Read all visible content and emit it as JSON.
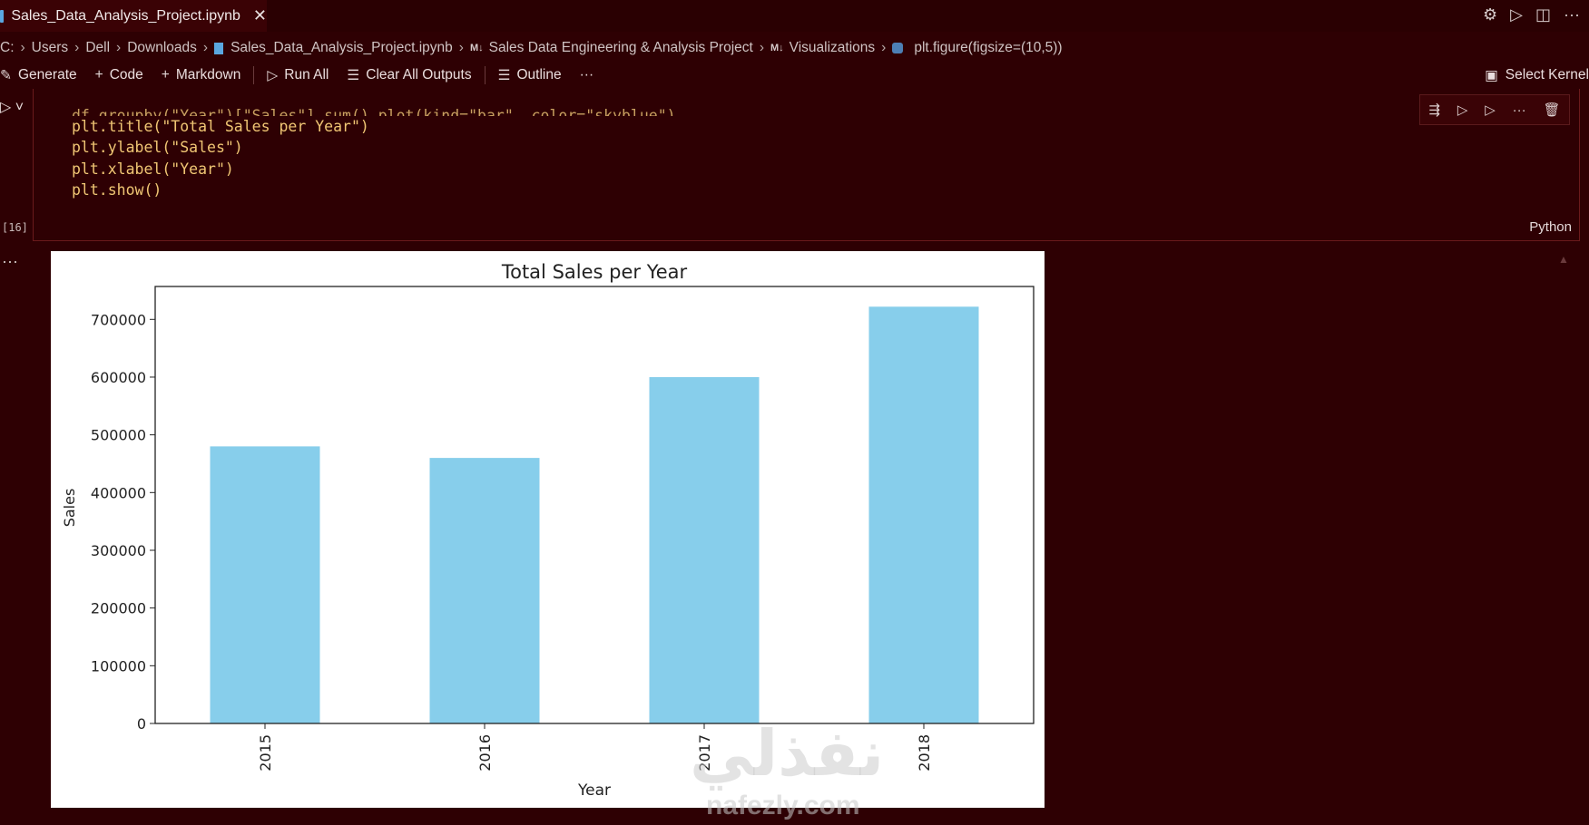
{
  "tab": {
    "title": "Sales_Data_Analysis_Project.ipynb",
    "close": "✕"
  },
  "tab_actions": [
    "gear-icon",
    "run-icon",
    "split-icon",
    "more-icon"
  ],
  "breadcrumb": {
    "items": [
      "C:",
      "Users",
      "Dell",
      "Downloads",
      "Sales_Data_Analysis_Project.ipynb",
      "Sales Data Engineering & Analysis Project",
      "Visualizations",
      "plt.figure(figsize=(10,5))"
    ],
    "md_badge": "M↓"
  },
  "toolbar": {
    "generate": "Generate",
    "code": "Code",
    "markdown": "Markdown",
    "run_all": "Run All",
    "clear_outputs": "Clear All Outputs",
    "outline": "Outline",
    "more": "···",
    "select_kernel": "Select Kernel"
  },
  "cell": {
    "exec_count": "[16]",
    "language": "Python",
    "lines": [
      "df.groupby(\"Year\")[\"Sales\"].sum().plot(kind=\"bar\", color=\"skyblue\")",
      "plt.title(\"Total Sales per Year\")",
      "plt.ylabel(\"Sales\")",
      "plt.xlabel(\"Year\")",
      "plt.show()"
    ]
  },
  "output": {
    "more": "···"
  },
  "watermark": {
    "arabic": "نفذلي",
    "latin": "nafezly.com"
  },
  "chart_data": {
    "type": "bar",
    "title": "Total Sales per Year",
    "xlabel": "Year",
    "ylabel": "Sales",
    "categories": [
      "2015",
      "2016",
      "2017",
      "2018"
    ],
    "values": [
      480000,
      460000,
      600000,
      722000
    ],
    "ylim": [
      0,
      757000
    ],
    "yticks": [
      0,
      100000,
      200000,
      300000,
      400000,
      500000,
      600000,
      700000
    ],
    "color": "#87ceeb",
    "grid": false
  }
}
